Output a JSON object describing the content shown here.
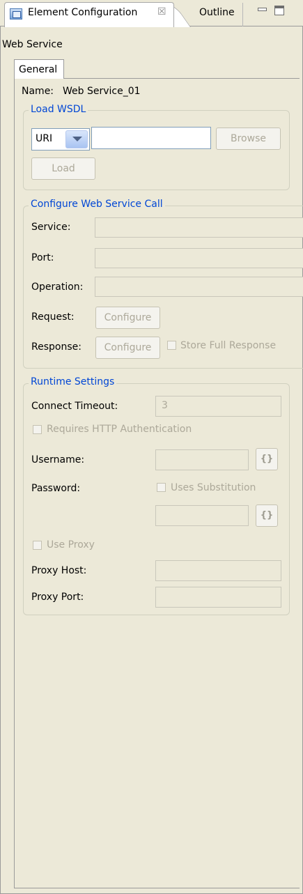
{
  "view_tabs": {
    "active_label": "Element Configuration",
    "close_symbol": "☒",
    "other_label": "Outline"
  },
  "page": {
    "title": "Web Service",
    "tab": "General"
  },
  "name": {
    "label": "Name:",
    "value": "Web Service_01"
  },
  "load_wsdl": {
    "legend": "Load WSDL",
    "source_type": "URI",
    "uri_value": "",
    "browse_label": "Browse",
    "load_label": "Load"
  },
  "configure_call": {
    "legend": "Configure Web Service Call",
    "service_label": "Service:",
    "port_label": "Port:",
    "operation_label": "Operation:",
    "request_label": "Request:",
    "request_button": "Configure",
    "response_label": "Response:",
    "response_button": "Configure",
    "store_full_response": "Store Full Response"
  },
  "runtime": {
    "legend": "Runtime Settings",
    "connect_timeout_label": "Connect Timeout:",
    "connect_timeout_value": "3",
    "requires_auth": "Requires HTTP Authentication",
    "username_label": "Username:",
    "password_label": "Password:",
    "uses_substitution": "Uses Substitution",
    "substitution_icon": "{}",
    "use_proxy": "Use Proxy",
    "proxy_host_label": "Proxy Host:",
    "proxy_port_label": "Proxy Port:"
  },
  "icons": [
    "view-icon",
    "close-icon",
    "minimize-icon",
    "maximize-icon",
    "dropdown-arrow-icon",
    "substitution-icon"
  ],
  "colors": {
    "background": "#ece9d8",
    "legend": "#0046d5",
    "disabled_text": "#aca899"
  }
}
